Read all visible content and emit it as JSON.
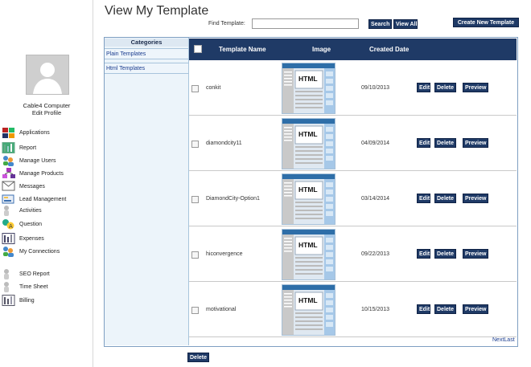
{
  "page": {
    "title": "View My Template"
  },
  "profile": {
    "name": "Cable4 Computer",
    "edit_label": "Edit Profile"
  },
  "nav": [
    {
      "label": "Applications",
      "icon": "applications-icon"
    },
    {
      "label": "Report",
      "icon": "report-icon"
    },
    {
      "label": "Manage Users",
      "icon": "users-icon"
    },
    {
      "label": "Manage Products",
      "icon": "products-icon"
    },
    {
      "label": "Messages",
      "icon": "messages-icon"
    },
    {
      "label": "Lead Management",
      "icon": "lead-icon"
    },
    {
      "label": "Activities",
      "icon": "person-icon"
    },
    {
      "label": "Question",
      "icon": "question-icon"
    },
    {
      "label": "Expenses",
      "icon": "expenses-icon"
    },
    {
      "label": "My Connections",
      "icon": "connections-icon"
    },
    {
      "label": "SEO Report",
      "icon": "person-icon"
    },
    {
      "label": "Time Sheet",
      "icon": "person-icon"
    },
    {
      "label": "Billing",
      "icon": "billing-icon"
    }
  ],
  "search": {
    "label": "Find Template:",
    "value": "",
    "placeholder": "",
    "search_button": "Search",
    "view_all_button": "View All"
  },
  "create_button": "Create New Template",
  "categories": {
    "header": "Categories",
    "items": [
      "Plain Templates",
      "Html Templates"
    ]
  },
  "table": {
    "headers": {
      "name": "Template Name",
      "image": "Image",
      "date": "Created Date"
    },
    "thumb_text": "HTML",
    "rows": [
      {
        "name": "conkit",
        "date": "09/10/2013"
      },
      {
        "name": "diamondcity11",
        "date": "04/09/2014"
      },
      {
        "name": "DiamondCity-Option1",
        "date": "03/14/2014"
      },
      {
        "name": "hiconvergence",
        "date": "09/22/2013"
      },
      {
        "name": "motivational",
        "date": "10/15/2013"
      }
    ],
    "row_buttons": {
      "edit": "Edit",
      "delete": "Delete",
      "preview": "Preview"
    }
  },
  "pager": {
    "next": "Next",
    "last": "Last"
  },
  "footer": {
    "delete_button": "Delete"
  },
  "colors": {
    "header_bg": "#1f3a66",
    "link": "#1b3d8f",
    "category_bg": "#ecf4fa"
  }
}
